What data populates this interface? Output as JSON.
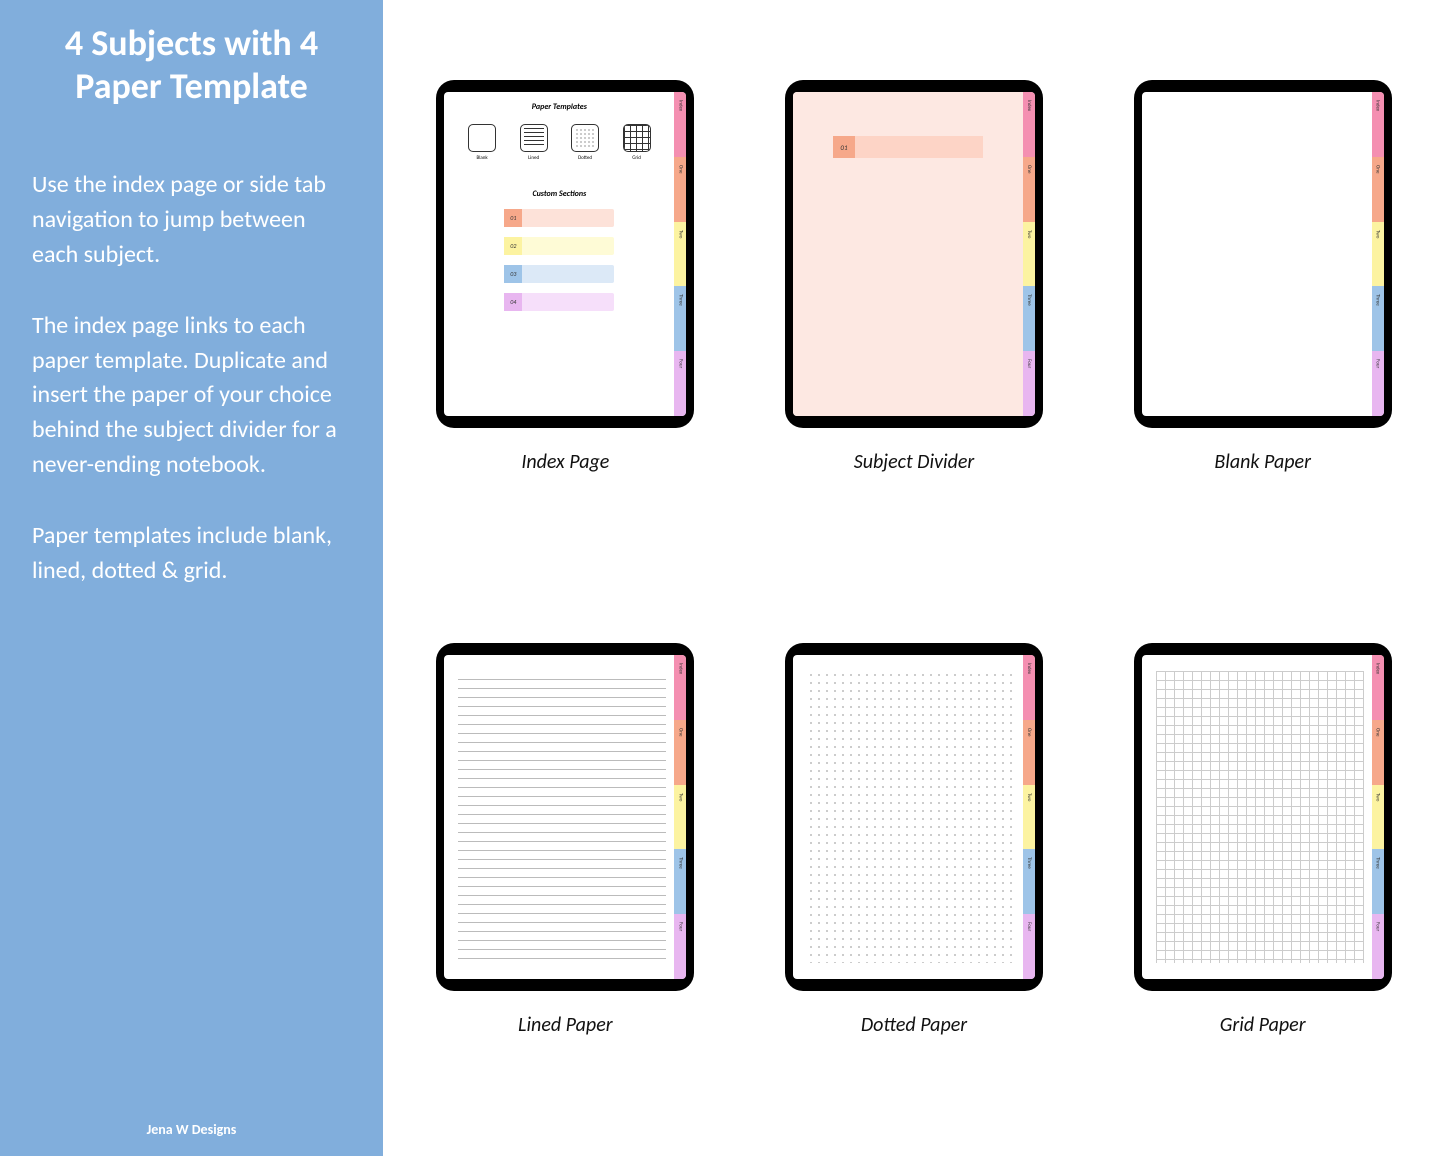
{
  "sidebar": {
    "title": "4 Subjects with 4 Paper Template",
    "para1": "Use the index page or side tab navigation to jump between each subject.",
    "para2": "The index page links to each paper template. Duplicate and insert the paper of your choice behind the subject divider for a never-ending notebook.",
    "para3": "Paper templates include blank, lined, dotted & grid.",
    "brand": "Jena W Designs"
  },
  "captions": {
    "index": "Index Page",
    "divider": "Subject Divider",
    "blank": "Blank Paper",
    "lined": "Lined Paper",
    "dotted": "Dotted Paper",
    "grid": "Grid Paper"
  },
  "index_page": {
    "templates_title": "Paper Templates",
    "custom_title": "Custom Sections",
    "template_items": {
      "blank": "Blank",
      "lined": "Lined",
      "dotted": "Dotted",
      "grid": "Grid"
    },
    "sections": {
      "s1": "01",
      "s2": "02",
      "s3": "03",
      "s4": "04"
    }
  },
  "divider_page": {
    "number": "01"
  },
  "tabs": {
    "index": "Index",
    "one": "One",
    "two": "Two",
    "three": "Three",
    "four": "Four"
  }
}
